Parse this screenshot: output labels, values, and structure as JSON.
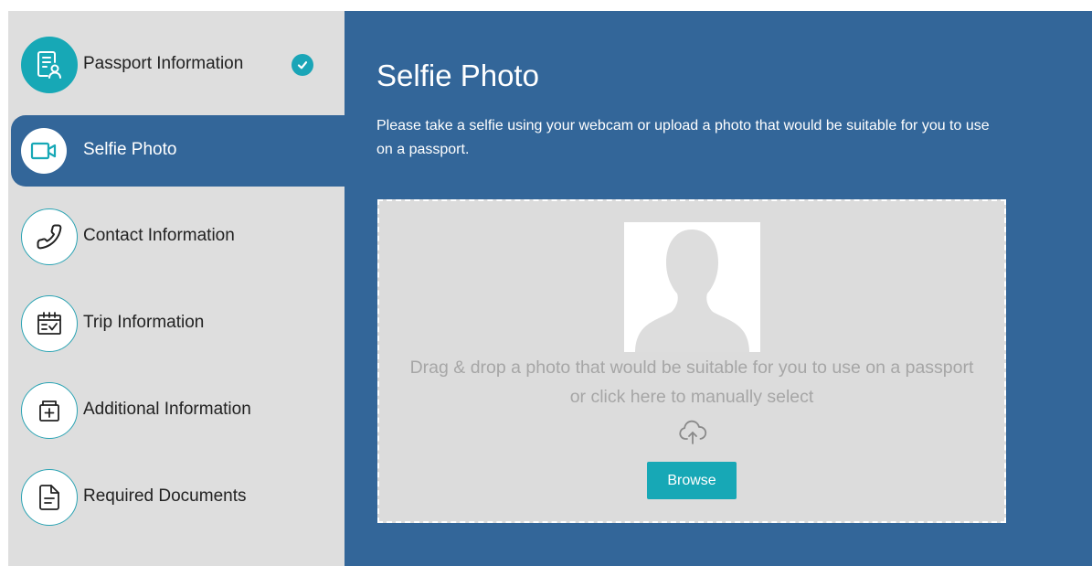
{
  "colors": {
    "accent": "#17a8b6",
    "primary": "#336699",
    "sidebar_bg": "#dedede",
    "dropzone_bg": "#dcdcdc"
  },
  "sidebar": {
    "steps": [
      {
        "label": "Passport Information",
        "icon": "passport-document-icon",
        "status": "completed"
      },
      {
        "label": "Selfie Photo",
        "icon": "camera-icon",
        "status": "active"
      },
      {
        "label": "Contact Information",
        "icon": "phone-icon",
        "status": "pending"
      },
      {
        "label": "Trip Information",
        "icon": "calendar-check-icon",
        "status": "pending"
      },
      {
        "label": "Additional Information",
        "icon": "medical-kit-icon",
        "status": "pending"
      },
      {
        "label": "Required Documents",
        "icon": "document-icon",
        "status": "pending"
      }
    ]
  },
  "main": {
    "title": "Selfie Photo",
    "description": "Please take a selfie using your webcam or upload a photo that would be suitable for you to use on a passport.",
    "dropzone": {
      "line1": "Drag & drop a photo that would be suitable for you to use on a passport",
      "line2": "or click here to manually select",
      "upload_icon": "cloud-upload-icon",
      "placeholder_icon": "person-silhouette-icon",
      "browse_label": "Browse"
    }
  }
}
